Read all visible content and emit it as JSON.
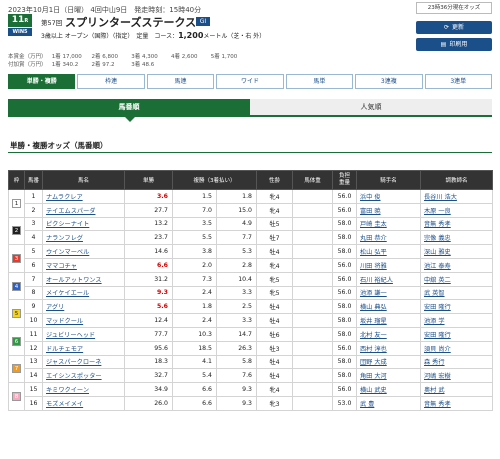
{
  "header": {
    "date_line": "2023年10月1日（日曜） 4回中山9日　発走時刻：15時40分",
    "race_no": "11",
    "race_no_suffix": "R",
    "win5": "WIN5",
    "race_ordinal": "第57回",
    "race_name": "スプリンターズステークス",
    "grade": "GⅠ",
    "conditions": "3歳以上 オープン（国際）（指定）　定量　コース：",
    "distance": "1,200",
    "distance_suffix": "メートル（芝・右 外）",
    "prize_main": [
      "本賞金（万円）",
      "1着 17,000",
      "2着 6,800",
      "3着 4,300",
      "4着 2,600",
      "5着 1,700"
    ],
    "prize_extra": [
      "付加賞（万円）",
      "1着 340.2",
      "2着 97.2",
      "3着 48.6"
    ],
    "timestamp": "23時36分現在オッズ",
    "refresh_label": "更新",
    "print_label": "印刷用",
    "refresh_icon": "refresh-icon",
    "print_icon": "print-icon"
  },
  "tabs": [
    "単勝・複勝",
    "枠連",
    "馬連",
    "ワイド",
    "馬単",
    "3連複",
    "3連単"
  ],
  "subtabs": [
    "馬番順",
    "人気順"
  ],
  "section_title": "単勝・複勝オッズ（馬番順）",
  "columns": [
    "枠",
    "馬番",
    "馬名",
    "単勝",
    "複勝（3着払い）",
    "",
    "性齢",
    "馬体重",
    "負担\n重量",
    "騎手名",
    "調教師名"
  ],
  "frame_colors": [
    "#ffffff",
    "#222222",
    "#e63b2e",
    "#2a62c9",
    "#f4d31c",
    "#2f9a44",
    "#f39a1d",
    "#f4a9c0"
  ],
  "rows": [
    {
      "frame": "1",
      "num": "1",
      "name": "ナムラクレア",
      "win": "3.6",
      "hot": true,
      "plo": "1.5",
      "phi": "1.8",
      "sex": "牝4",
      "bw": "",
      "wt": "56.0",
      "jockey": "浜中 俊",
      "trainer": "長谷川 浩大"
    },
    {
      "frame": "",
      "num": "2",
      "name": "テイエムスパーダ",
      "win": "27.7",
      "hot": false,
      "plo": "7.0",
      "phi": "15.0",
      "sex": "牝4",
      "bw": "",
      "wt": "56.0",
      "jockey": "富田 暁",
      "trainer": "木原 一良"
    },
    {
      "frame": "2",
      "num": "3",
      "name": "ピクシーナイト",
      "win": "13.2",
      "hot": false,
      "plo": "3.5",
      "phi": "4.9",
      "sex": "牡5",
      "bw": "",
      "wt": "58.0",
      "jockey": "戸崎 圭太",
      "trainer": "音無 秀孝"
    },
    {
      "frame": "",
      "num": "4",
      "name": "ナランフレグ",
      "win": "23.7",
      "hot": false,
      "plo": "5.5",
      "phi": "7.7",
      "sex": "牡7",
      "bw": "",
      "wt": "58.0",
      "jockey": "丸田 恭介",
      "trainer": "宗像 義忠"
    },
    {
      "frame": "3",
      "num": "5",
      "name": "ウインマーベル",
      "win": "14.6",
      "hot": false,
      "plo": "3.8",
      "phi": "5.3",
      "sex": "牡4",
      "bw": "",
      "wt": "58.0",
      "jockey": "松山 弘平",
      "trainer": "深山 雅史"
    },
    {
      "frame": "",
      "num": "6",
      "name": "ママコチャ",
      "win": "6.6",
      "hot": true,
      "plo": "2.0",
      "phi": "2.8",
      "sex": "牝4",
      "bw": "",
      "wt": "56.0",
      "jockey": "川田 将雅",
      "trainer": "池江 泰寿"
    },
    {
      "frame": "4",
      "num": "7",
      "name": "オールアットワンス",
      "win": "31.2",
      "hot": false,
      "plo": "7.3",
      "phi": "10.4",
      "sex": "牝5",
      "bw": "",
      "wt": "56.0",
      "jockey": "石川 裕紀人",
      "trainer": "中舘 英二"
    },
    {
      "frame": "",
      "num": "8",
      "name": "メイケイエール",
      "win": "9.3",
      "hot": true,
      "plo": "2.4",
      "phi": "3.3",
      "sex": "牝5",
      "bw": "",
      "wt": "56.0",
      "jockey": "池添 謙一",
      "trainer": "武 英智"
    },
    {
      "frame": "5",
      "num": "9",
      "name": "アグリ",
      "win": "5.6",
      "hot": true,
      "plo": "1.8",
      "phi": "2.5",
      "sex": "牡4",
      "bw": "",
      "wt": "58.0",
      "jockey": "横山 典弘",
      "trainer": "安田 隆行"
    },
    {
      "frame": "",
      "num": "10",
      "name": "マッドクール",
      "win": "12.4",
      "hot": false,
      "plo": "2.4",
      "phi": "3.3",
      "sex": "牡4",
      "bw": "",
      "wt": "58.0",
      "jockey": "坂井 瑠星",
      "trainer": "池添 学"
    },
    {
      "frame": "6",
      "num": "11",
      "name": "ジュビリーヘッド",
      "win": "77.7",
      "hot": false,
      "plo": "10.3",
      "phi": "14.7",
      "sex": "牡6",
      "bw": "",
      "wt": "58.0",
      "jockey": "北村 友一",
      "trainer": "安田 隆行"
    },
    {
      "frame": "",
      "num": "12",
      "name": "ドルチェモア",
      "win": "95.6",
      "hot": false,
      "plo": "18.5",
      "phi": "26.3",
      "sex": "牡3",
      "bw": "",
      "wt": "56.0",
      "jockey": "西村 淳也",
      "trainer": "須貝 尚介"
    },
    {
      "frame": "7",
      "num": "13",
      "name": "ジャスパークローネ",
      "win": "18.3",
      "hot": false,
      "plo": "4.1",
      "phi": "5.8",
      "sex": "牡4",
      "bw": "",
      "wt": "58.0",
      "jockey": "団野 大成",
      "trainer": "森 秀行"
    },
    {
      "frame": "",
      "num": "14",
      "name": "エイシンスポッター",
      "win": "32.7",
      "hot": false,
      "plo": "5.4",
      "phi": "7.6",
      "sex": "牡4",
      "bw": "",
      "wt": "58.0",
      "jockey": "角田 大河",
      "trainer": "河嶋 宏樹"
    },
    {
      "frame": "8",
      "num": "15",
      "name": "キミワクイーン",
      "win": "34.9",
      "hot": false,
      "plo": "6.6",
      "phi": "9.3",
      "sex": "牝4",
      "bw": "",
      "wt": "56.0",
      "jockey": "横山 武史",
      "trainer": "奥村 武"
    },
    {
      "frame": "",
      "num": "16",
      "name": "モズメイメイ",
      "win": "26.0",
      "hot": false,
      "plo": "6.6",
      "phi": "9.3",
      "sex": "牝3",
      "bw": "",
      "wt": "53.0",
      "jockey": "武 豊",
      "trainer": "音無 秀孝"
    }
  ]
}
